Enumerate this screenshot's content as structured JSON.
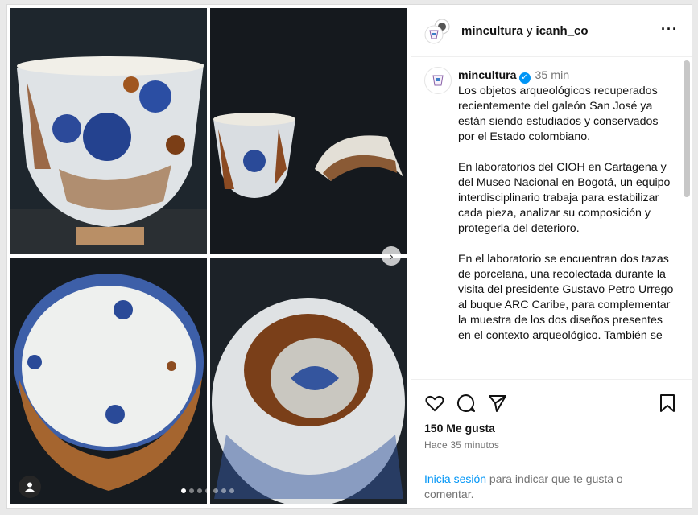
{
  "header": {
    "account_1": "mincultura",
    "connector": "y",
    "account_2": "icanh_co",
    "more_icon": "more-horizontal-icon"
  },
  "caption": {
    "username": "mincultura",
    "verified_icon": "verified-badge-icon",
    "time": "35 min",
    "paragraphs": [
      "Los objetos arqueológicos recuperados recientemente del galeón San José ya están siendo estudiados y conservados por el Estado colombiano.",
      "En laboratorios del CIOH en Cartagena y del Museo Nacional en Bogotá, un equipo interdisciplinario trabaja para estabilizar cada pieza, analizar su composición y protegerla del deterioro.",
      "En el laboratorio se encuentran dos tazas de porcelana, una recolectada durante la visita del presidente Gustavo Petro Urrego al buque ARC Caribe, para complementar la muestra de los dos diseños presentes en el contexto arqueológico. También se"
    ]
  },
  "actions": {
    "likes": "150 Me gusta",
    "time_ago": "Hace 35 minutos",
    "login_link": "Inicia sesión",
    "login_rest": " para indicar que te gusta o comentar."
  },
  "carousel": {
    "total_dots": 7,
    "active_index": 0,
    "next_icon": "chevron-right-icon",
    "user_tag_icon": "user-icon"
  },
  "colors": {
    "accent": "#0095f6",
    "secondary_text": "#737373"
  }
}
